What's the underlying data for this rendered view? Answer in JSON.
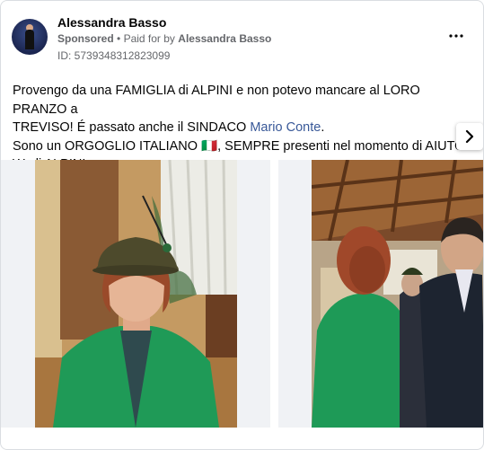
{
  "post": {
    "author": "Alessandra Basso",
    "sponsored": "Sponsored",
    "paid_prefix": "Paid for by",
    "paid_by": "Alessandra Basso",
    "ad_id": "ID: 5739348312823099",
    "more_icon": "more-horizontal-icon",
    "text_lines": {
      "l1": "Provengo da una FAMIGLIA di ALPINI e non potevo mancare al LORO PRANZO a",
      "l2_a": "TREVISO! É passato anche il SINDACO ",
      "l2_link": "Mario Conte",
      "l2_b": ".",
      "l3": "Sono un ORGOGLIO ITALIANO 🇮🇹, SEMPRE presenti nel momento di AIUTO!",
      "l4": "W gli ALPINI"
    },
    "link_color": "#385898"
  },
  "carousel": {
    "next_icon": "chevron-right-icon"
  }
}
